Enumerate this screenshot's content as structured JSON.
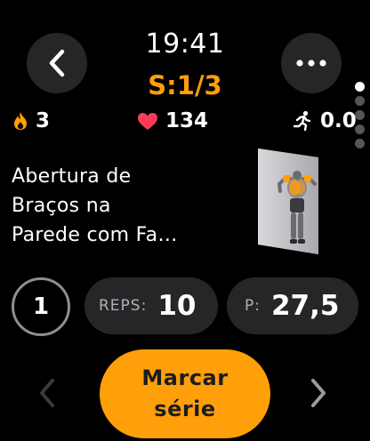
{
  "header": {
    "time": "19:41",
    "set_label": "S:1/3"
  },
  "stats": {
    "fire_count": "3",
    "heart_rate": "134",
    "distance": "0.0"
  },
  "exercise": {
    "title_line1": "Abertura de",
    "title_line2": "Braços na",
    "title_line3": "Parede com Fa…"
  },
  "inputs": {
    "set_number": "1",
    "reps_label": "REPS:",
    "reps_value": "10",
    "weight_label": "P:",
    "weight_value": "27,5"
  },
  "actions": {
    "mark_line1": "Marcar",
    "mark_line2": "série"
  },
  "pager": {
    "count": 5,
    "active": 0
  },
  "colors": {
    "accent": "#ff9f0a",
    "surface": "#262628",
    "heart": "#ff3b5c"
  },
  "icons": [
    "chevron-left-icon",
    "more-icon",
    "fire-icon",
    "heart-icon",
    "runner-icon",
    "chevron-right-icon"
  ]
}
